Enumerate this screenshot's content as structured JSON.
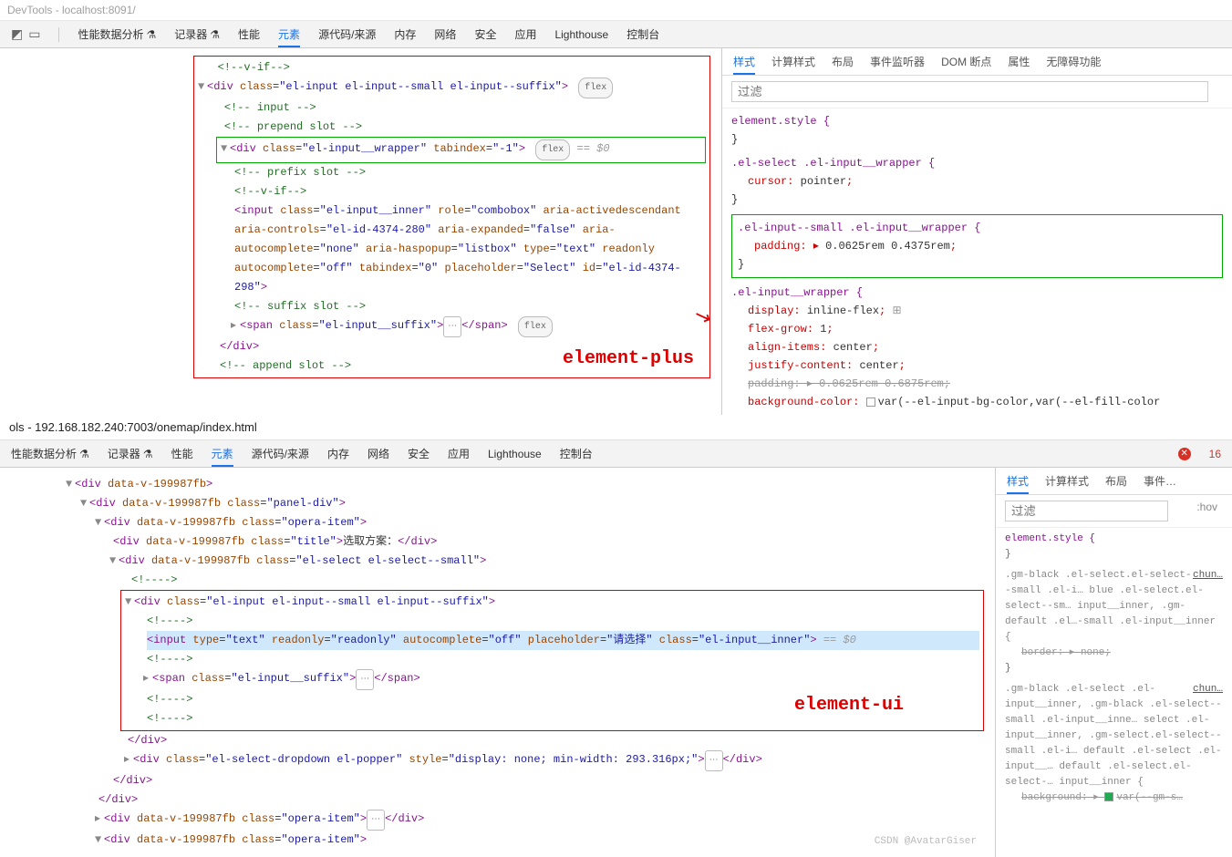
{
  "win1": {
    "title": "DevTools - localhost:8091/"
  },
  "toolbar": {
    "items": [
      "性能数据分析",
      "记录器",
      "性能",
      "元素",
      "源代码/来源",
      "内存",
      "网络",
      "安全",
      "应用",
      "Lighthouse",
      "控制台"
    ],
    "active": 3,
    "flask": "⚗"
  },
  "dom1": {
    "l0": "<!--v-if-->",
    "l1_open": "<div class=\"el-input el-input--small el-input--suffix\">",
    "l1_flex": "flex",
    "c1": "<!-- input -->",
    "c2": "<!-- prepend slot -->",
    "l2_open": "<div class=\"el-input__wrapper\" tabindex=\"-1\">",
    "l2_flex": "flex",
    "l2_eq": "== $0",
    "c3": "<!-- prefix slot -->",
    "c4": "<!--v-if-->",
    "input": "<input class=\"el-input__inner\" role=\"combobox\" aria-activedescendant aria-controls=\"el-id-4374-280\" aria-expanded=\"false\" aria-autocomplete=\"none\" aria-haspopup=\"listbox\" type=\"text\" readonly autocomplete=\"off\" tabindex=\"0\" placeholder=\"Select\" id=\"el-id-4374-298\">",
    "c5": "<!-- suffix slot -->",
    "span_open": "<span class=\"el-input__suffix\">",
    "span_close": "</span>",
    "span_flex": "flex",
    "div_close": "</div>",
    "c6": "<!-- append slot -->",
    "label": "element-plus"
  },
  "styles1": {
    "tabs": [
      "样式",
      "计算样式",
      "布局",
      "事件监听器",
      "DOM 断点",
      "属性",
      "无障碍功能"
    ],
    "filter_ph": "过滤",
    "r0": "element.style {",
    "r0c": "}",
    "r1": ".el-select .el-input__wrapper {",
    "r1p": "cursor: pointer;",
    "r1c": "}",
    "r2": ".el-input--small .el-input__wrapper {",
    "r2p": "padding: ▸ 0.0625rem 0.4375rem;",
    "r2c": "}",
    "r3": ".el-input__wrapper {",
    "r3p": [
      "display: inline-flex;",
      "flex-grow: 1;",
      "align-items: center;",
      "justify-content: center;",
      "padding: ▸ 0.0625rem 0.6875rem;",
      "background-color:  var(--el-input-bg-color,var(--el-fill-color"
    ]
  },
  "win2": {
    "title": "ols - 192.168.182.240:7003/onemap/index.html"
  },
  "toolbar2": {
    "items": [
      "性能数据分析",
      "记录器",
      "性能",
      "元素",
      "源代码/来源",
      "内存",
      "网络",
      "安全",
      "应用",
      "Lighthouse",
      "控制台"
    ],
    "active": 3,
    "err": "16"
  },
  "dom2": {
    "l0": "<div data-v-199987fb>",
    "l1": "<div data-v-199987fb class=\"panel-div\">",
    "l2": "<div data-v-199987fb class=\"opera-item\">",
    "l3a": "<div data-v-199987fb class=\"title\">",
    "l3t": "选取方案：",
    "l3b": "</div>",
    "l4": "<div data-v-199987fb class=\"el-select el-select--small\">",
    "c1": "<!---->",
    "l5": "<div class=\"el-input el-input--small el-input--suffix\">",
    "inp": "<input type=\"text\" readonly=\"readonly\" autocomplete=\"off\" placeholder=\"请选择\" class=\"el-input__inner\">",
    "eq": "== $0",
    "sp": "<span class=\"el-input__suffix\">",
    "spc": "</span>",
    "dvc": "</div>",
    "dd": "<div class=\"el-select-dropdown el-popper\" style=\"display: none; min-width: 293.316px;\">",
    "ddc": "</div>",
    "oi": "<div data-v-199987fb class=\"opera-item\">",
    "oic": "</div>",
    "label": "element-ui"
  },
  "styles2": {
    "tabs": [
      "样式",
      "计算样式",
      "布局",
      "事件…"
    ],
    "filter_ph": "过滤",
    "hov": ":hov",
    "r0": "element.style {",
    "r0c": "}",
    "link": "chun…",
    "r1": ".gm-black .el-select.el-select--small .el-i… blue .el-select.el-select--sm… input__inner, .gm-default .el…-small .el-input__inner {",
    "r1p": "border: ▸ none;",
    "r1c": "}",
    "r2": ".gm-black .el-select .el-input__inner, .gm-black .el-select--small .el-input__inne… select .el-input__inner, .gm-select.el-select--small .el-i… default .el-select .el-input__… default .el-select.el-select-… input__inner {",
    "r2p": "background: ▸  var(--gm-s…"
  },
  "watermark": "CSDN @AvatarGiser"
}
